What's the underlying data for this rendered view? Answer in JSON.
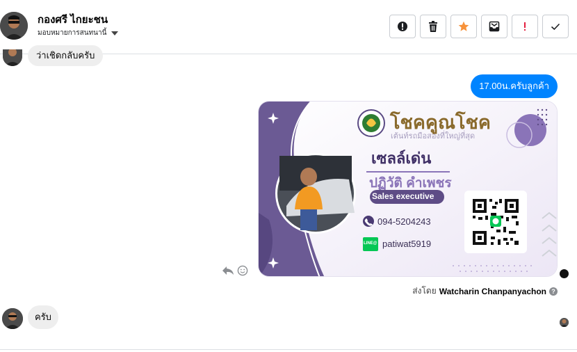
{
  "header": {
    "contact_name": "กองศรี ไกยะชน",
    "assign_label": "มอบหมายการสนทนานี้",
    "actions": [
      {
        "icon": "alert-circle-icon",
        "color": "#1c1e21"
      },
      {
        "icon": "trash-icon",
        "color": "#1c1e21"
      },
      {
        "icon": "star-icon",
        "color": "#f7923a"
      },
      {
        "icon": "archive-mail-icon",
        "color": "#1c1e21"
      },
      {
        "icon": "exclamation-icon",
        "color": "#e41e3f"
      },
      {
        "icon": "check-icon",
        "color": "#1c1e21"
      }
    ]
  },
  "messages": {
    "top_partial": "ว่าเชิดกลับครับ",
    "outgoing_text": "17.00น.ครับลูกค้า",
    "sent_by_prefix": "ส่งโดย",
    "sent_by_name": "Watcharin Chanpanyachon",
    "help_glyph": "?",
    "incoming_text": "ครับ"
  },
  "card": {
    "brand": "โชคคูณโชค",
    "brand_sub": "เต้นท์รถมือสองที่ใหญ่ที่สุด",
    "role": "เซลล์เด่น",
    "person_name": "ปฏิวัติ  คำเพชร",
    "position": "Sales executive",
    "phone": "094-5204243",
    "line_badge": "LINE@",
    "line_id": "patiwat5919",
    "colors": {
      "purple": "#6b5a94",
      "dark_purple": "#4a3a73",
      "light_purple": "#efeaf6",
      "gold": "#b48a3c",
      "line_green": "#06c755"
    }
  },
  "colors": {
    "accent": "#0084ff",
    "bubble_in": "#eeeeee",
    "border": "#dcdfe3"
  }
}
